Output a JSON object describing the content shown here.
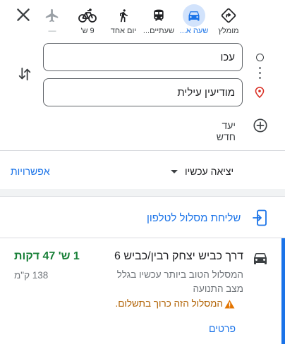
{
  "modes": [
    {
      "key": "recommended",
      "label": "מומלץ",
      "icon": "diamond-directions-icon",
      "active": false
    },
    {
      "key": "driving",
      "label": "שעה א...",
      "icon": "car-icon",
      "active": true
    },
    {
      "key": "transit",
      "label": "שעתיים...",
      "icon": "train-icon",
      "active": false
    },
    {
      "key": "walking",
      "label": "יום אחד",
      "icon": "walk-icon",
      "active": false
    },
    {
      "key": "cycling",
      "label": "9 ש'",
      "icon": "bicycle-icon",
      "active": false
    },
    {
      "key": "flight",
      "label": "—",
      "icon": "airplane-icon",
      "active": false
    }
  ],
  "origin": {
    "value": "עכו"
  },
  "destination": {
    "value": "מודיעין עילית"
  },
  "add_destination": {
    "label": "יעד חדש"
  },
  "depart": {
    "label": "יציאה עכשיו",
    "options_label": "אפשרויות"
  },
  "send_to_phone": {
    "label": "שליחת מסלול לטלפון"
  },
  "route": {
    "title": "דרך כביש יצחק רבין/כביש 6",
    "duration": "1 ש' 47 דקות",
    "description": "המסלול הטוב ביותר עכשיו בגלל מצב התנועה",
    "distance": "138 ק\"מ",
    "warning": "המסלול הזה כרוך בתשלום.",
    "details_label": "פרטים"
  },
  "colors": {
    "accent": "#1a73e8",
    "duration_green": "#188038",
    "warning": "#b06000"
  }
}
